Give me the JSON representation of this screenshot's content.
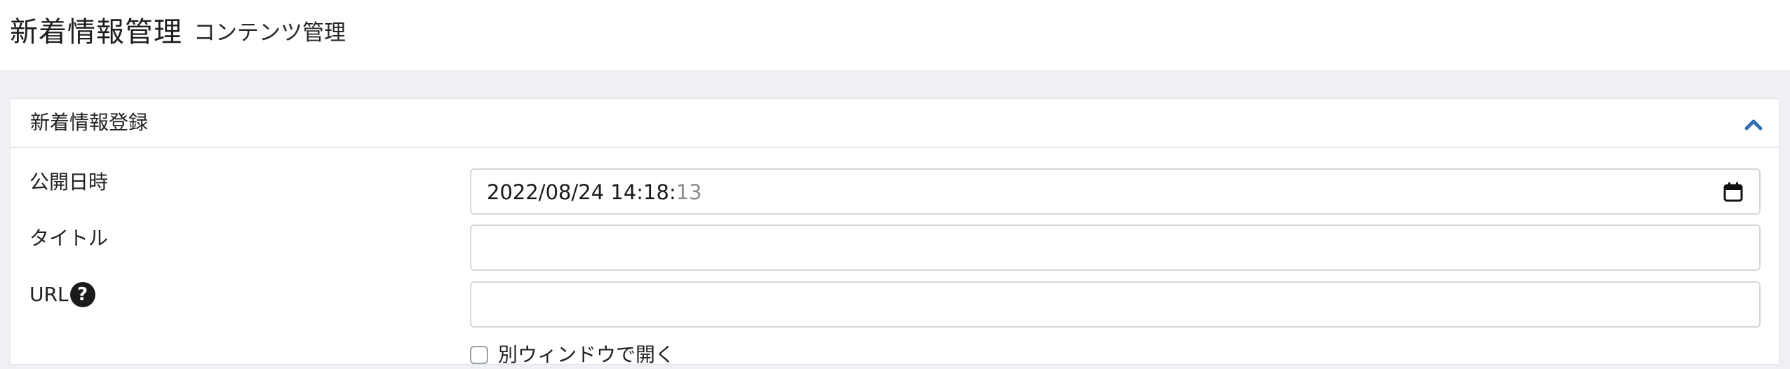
{
  "header": {
    "title": "新着情報管理",
    "subtitle": "コンテンツ管理"
  },
  "card": {
    "title": "新着情報登録",
    "toggle_icon": "chevron-up-icon",
    "accent_color": "#2f6db5"
  },
  "form": {
    "publish_date": {
      "label": "公開日時",
      "value_main": "2022/08/24 14:18:",
      "value_seconds": "13",
      "icon": "calendar-icon"
    },
    "title": {
      "label": "タイトル",
      "value": ""
    },
    "url": {
      "label": "URL",
      "value": "",
      "help_icon": "question-circle-icon",
      "help_glyph": "?"
    },
    "new_window": {
      "label": "別ウィンドウで開く",
      "checked": false
    }
  }
}
